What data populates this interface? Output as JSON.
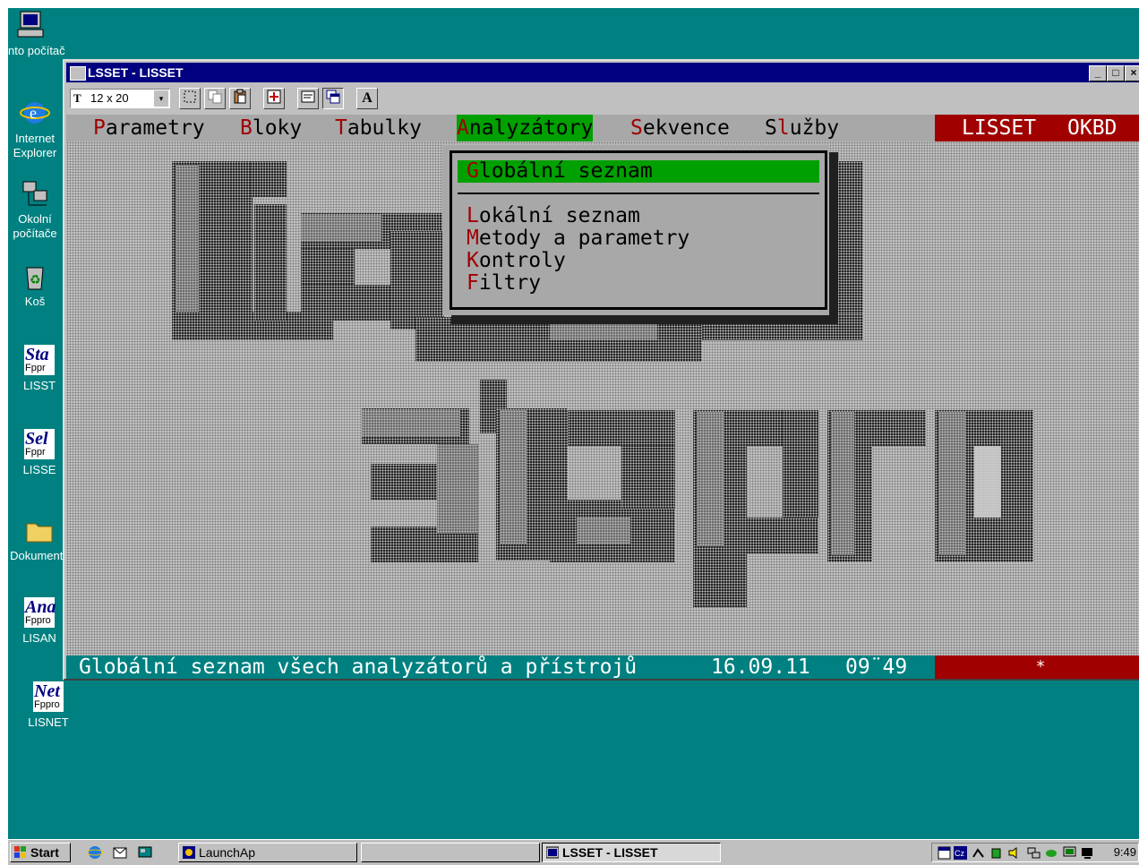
{
  "desktop": {
    "icons": [
      {
        "id": "pc",
        "label": "Tento počítač"
      },
      {
        "id": "ie",
        "label": "Internet Explorer"
      },
      {
        "id": "net",
        "label": "Okolní počítače"
      },
      {
        "id": "bin",
        "label": "Koš"
      },
      {
        "id": "lisst",
        "label": "LISST",
        "badge": "Sta",
        "sub": "Fppr"
      },
      {
        "id": "lisse",
        "label": "LISSE",
        "badge": "Sel",
        "sub": "Fppr"
      },
      {
        "id": "docs",
        "label": "Dokumenty"
      },
      {
        "id": "lisan",
        "label": "LISAN",
        "badge": "Ana",
        "sub": "Fppro"
      },
      {
        "id": "lisnet",
        "label": "LISNET",
        "badge": "Net",
        "sub": "Fppro"
      }
    ]
  },
  "window": {
    "title": "LSSET - LISSET",
    "controls": {
      "minimize": "_",
      "maximize": "□",
      "close": "×"
    },
    "toolbar": {
      "font_size": "12 x 20",
      "font_icon": "T",
      "dropdown_arrow": "▾",
      "text_button": "A"
    }
  },
  "console": {
    "menu": [
      {
        "hotkey": "P",
        "rest": "arametry"
      },
      {
        "hotkey": "B",
        "rest": "loky"
      },
      {
        "hotkey": "T",
        "rest": "abulky"
      },
      {
        "hotkey": "A",
        "rest": "nalyzátory"
      },
      {
        "hotkey": "S",
        "rest": "ekvence"
      },
      {
        "prefix": "S",
        "hotkey": "l",
        "rest": "užby"
      }
    ],
    "brand_left": "LISSET",
    "brand_right": "OKBD",
    "dropdown": [
      {
        "hotkey": "G",
        "rest": "lobální seznam"
      },
      {
        "hotkey": "L",
        "rest": "okální seznam"
      },
      {
        "hotkey": "M",
        "rest": "etody a parametry"
      },
      {
        "hotkey": "K",
        "rest": "ontroly"
      },
      {
        "hotkey": "F",
        "rest": "iltry"
      }
    ],
    "status": {
      "message": "Globální seznam všech analyzátorů a přístrojů",
      "date": "16.09.11",
      "time": "09¨49",
      "indicator": "*"
    }
  },
  "taskbar": {
    "start": "Start",
    "launch": "LaunchAp",
    "active_window": "LSSET - LISSET",
    "clock": "9:49"
  },
  "colors": {
    "desktop": "#008080",
    "title_active": "#000080",
    "menu_highlight": "#00a000",
    "hotkey": "#a00000",
    "brand_bg": "#a00000"
  }
}
